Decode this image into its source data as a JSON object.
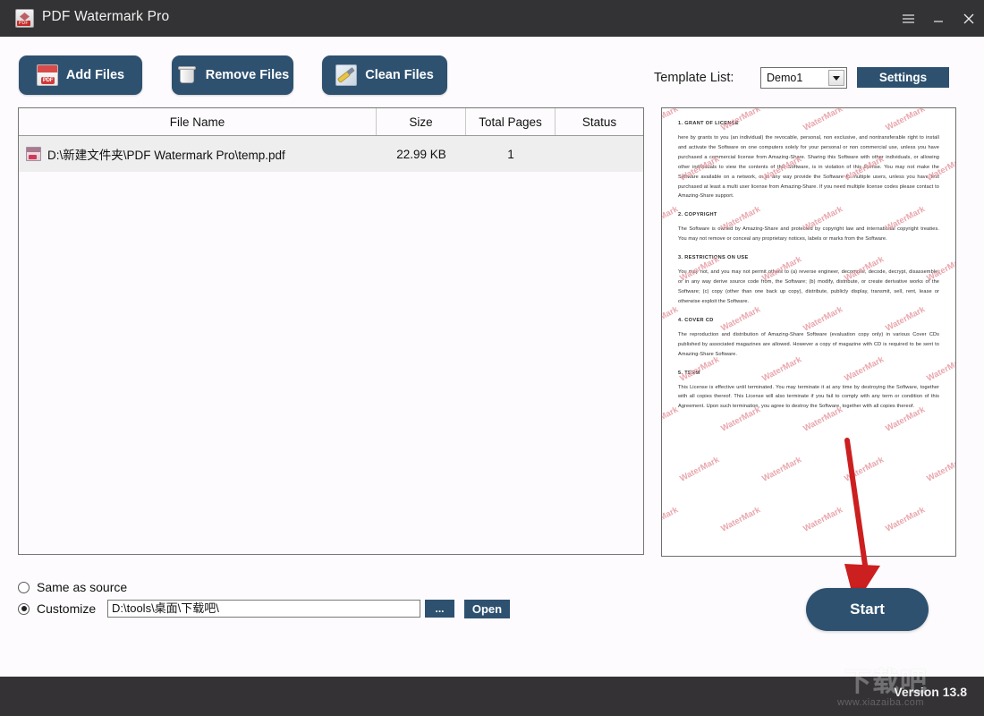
{
  "window": {
    "title": "PDF Watermark Pro",
    "app_icon": "pdf-document-icon",
    "controls": {
      "menu": "menu-hamburger-icon",
      "minimize": "minimize-icon",
      "close": "close-icon"
    }
  },
  "toolbar": {
    "add_files": "Add Files",
    "remove_files": "Remove Files",
    "clean_files": "Clean Files"
  },
  "template": {
    "label": "Template List:",
    "selected": "Demo1",
    "options": [
      "Demo1"
    ],
    "settings_label": "Settings"
  },
  "file_table": {
    "columns": [
      "File Name",
      "Size",
      "Total Pages",
      "Status"
    ],
    "rows": [
      {
        "file_name": "D:\\新建文件夹\\PDF Watermark Pro\\temp.pdf",
        "size": "22.99 KB",
        "total_pages": "1",
        "status": ""
      }
    ]
  },
  "output": {
    "same_as_source_label": "Same as source",
    "customize_label": "Customize",
    "path_value": "D:\\tools\\桌面\\下载吧\\",
    "browse_label": "...",
    "open_label": "Open",
    "selected_option": "customize"
  },
  "preview": {
    "watermark_text": "WaterMark",
    "sections": [
      {
        "heading": "1. GRANT OF LICENSE",
        "body": "here by grants to you (an individual) the revocable, personal, non exclusive, and nontransferable right to install and activate the Software on one computers solely for your personal or non commercial use, unless you have purchased a commercial license from Amazing-Share. Sharing this Software with other individuals, or allowing other individuals to view the contents of this Software, is in violation of this license. You may not make the Software available on a network, or in any way provide the Software to multiple users, unless you have first purchased at least a multi user license from Amazing-Share. If you need multiple license codes please contact to Amazing-Share support."
      },
      {
        "heading": "2. COPYRIGHT",
        "body": "The Software is owned by Amazing-Share and protected by copyright law and international copyright treaties. You may not remove or conceal any proprietary notices, labels or marks from the Software."
      },
      {
        "heading": "3. RESTRICTIONS ON USE",
        "body": "You may not, and you may not permit others to (a) reverse engineer, decompile, decode, decrypt, disassemble, or in any way derive source code from, the Software; (b) modify, distribute, or create derivative works of the Software; (c) copy (other than one back up copy), distribute, publicly display, transmit, sell, rent, lease or otherwise exploit the Software."
      },
      {
        "heading": "4. COVER CD",
        "body": "The reproduction and distribution of Amazing-Share Software (evaluation copy only) in various Cover CDs published by associated magazines are allowed. However a copy of magazine with CD is required to be sent to Amazing-Share Software."
      },
      {
        "heading": "5. TERM",
        "body": "This License is effective until terminated. You may terminate it at any time by destroying the Software, together with all copies thereof. This License will also terminate if you fail to comply with any term or condition of this Agreement. Upon such termination, you agree to destroy the Software, together with all copies thereof."
      }
    ]
  },
  "start_button": {
    "label": "Start"
  },
  "footer": {
    "version": "Version 13.8",
    "site_watermark_cn": "下载吧",
    "site_watermark_url": "www.xiazaiba.com"
  },
  "colors": {
    "accent": "#2e5170",
    "titlebar": "#333234",
    "annotation_arrow": "#cc1f1f",
    "watermark": "#e8a0a8"
  }
}
